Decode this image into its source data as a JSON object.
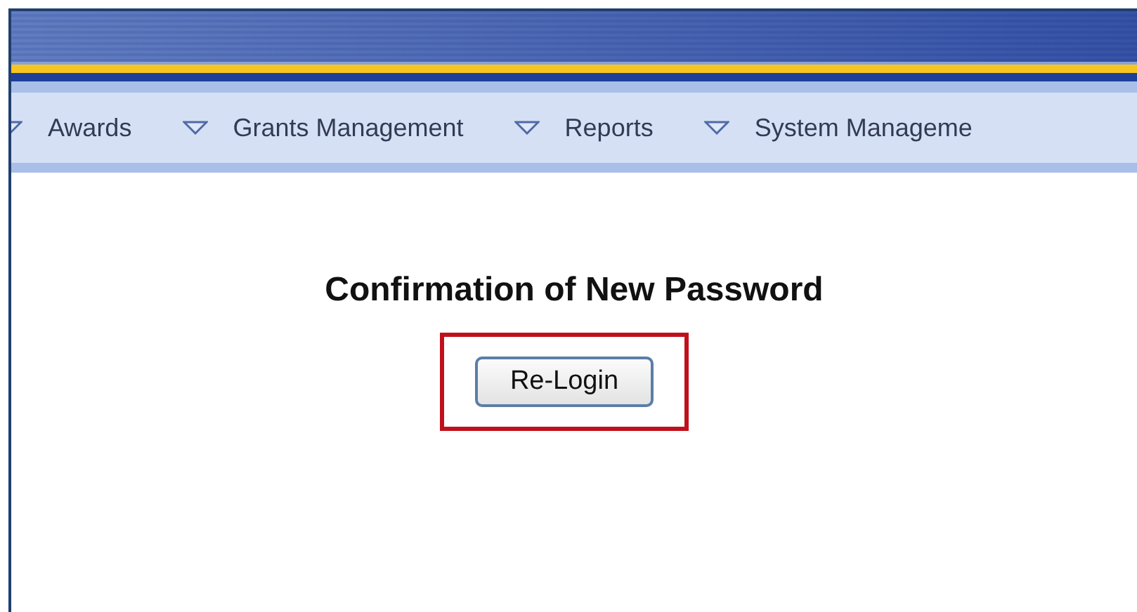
{
  "menu": [
    {
      "label": "Awards"
    },
    {
      "label": "Grants Management"
    },
    {
      "label": "Reports"
    },
    {
      "label": "System Manageme"
    }
  ],
  "heading": "Confirmation of New Password",
  "button": {
    "label": "Re-Login",
    "highlighted": true
  }
}
